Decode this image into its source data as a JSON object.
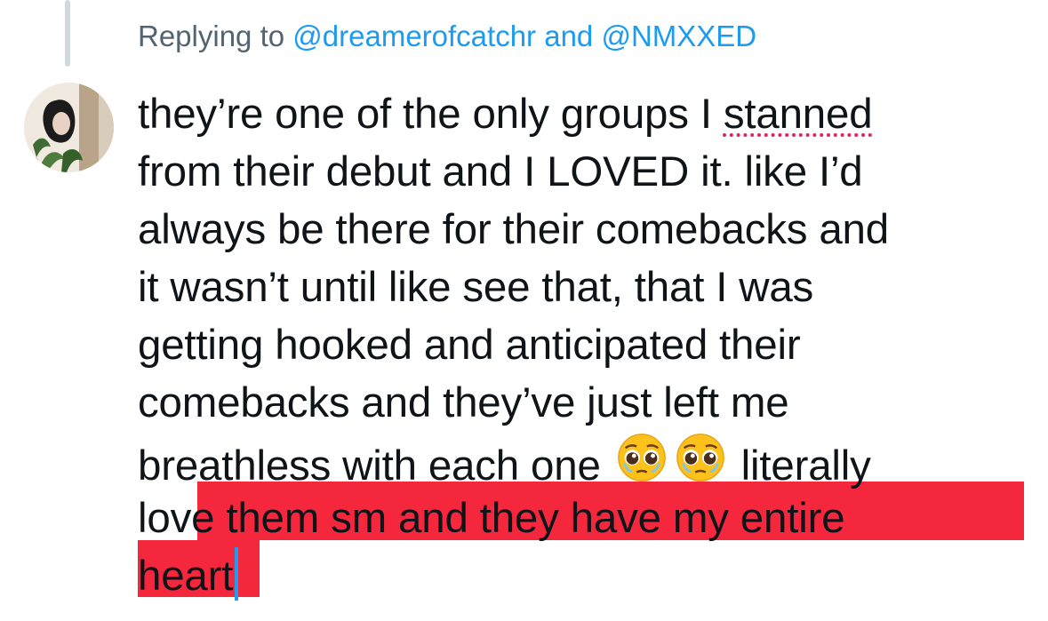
{
  "reply": {
    "prefix": "Replying to",
    "handle1": "@dreamerofcatchr",
    "joiner": "and",
    "handle2": "@NMXXED"
  },
  "tweet": {
    "l1a": "they’re one of the only groups I ",
    "l1b": "stanned",
    "l2": "from their debut and I LOVED it. like I’d",
    "l3": "always be there for their comebacks and",
    "l4": "it wasn’t until like see that, that I was",
    "l5": "getting hooked and anticipated their",
    "l6": "comebacks and they’ve just left me",
    "l7a": "breathless with each one",
    "l7b": "literally",
    "l8a": "lov",
    "l8b": "e them sm and they have my entire",
    "l9": "heart"
  },
  "icons": {
    "avatar": "profile-photo",
    "emoji": "pleading-face-emoji"
  },
  "colors": {
    "handle": "#1d9bf0",
    "meta": "#536471",
    "highlight": "#f5273d",
    "caret": "#1d9bf0",
    "spellcheck": "#e0245e"
  }
}
